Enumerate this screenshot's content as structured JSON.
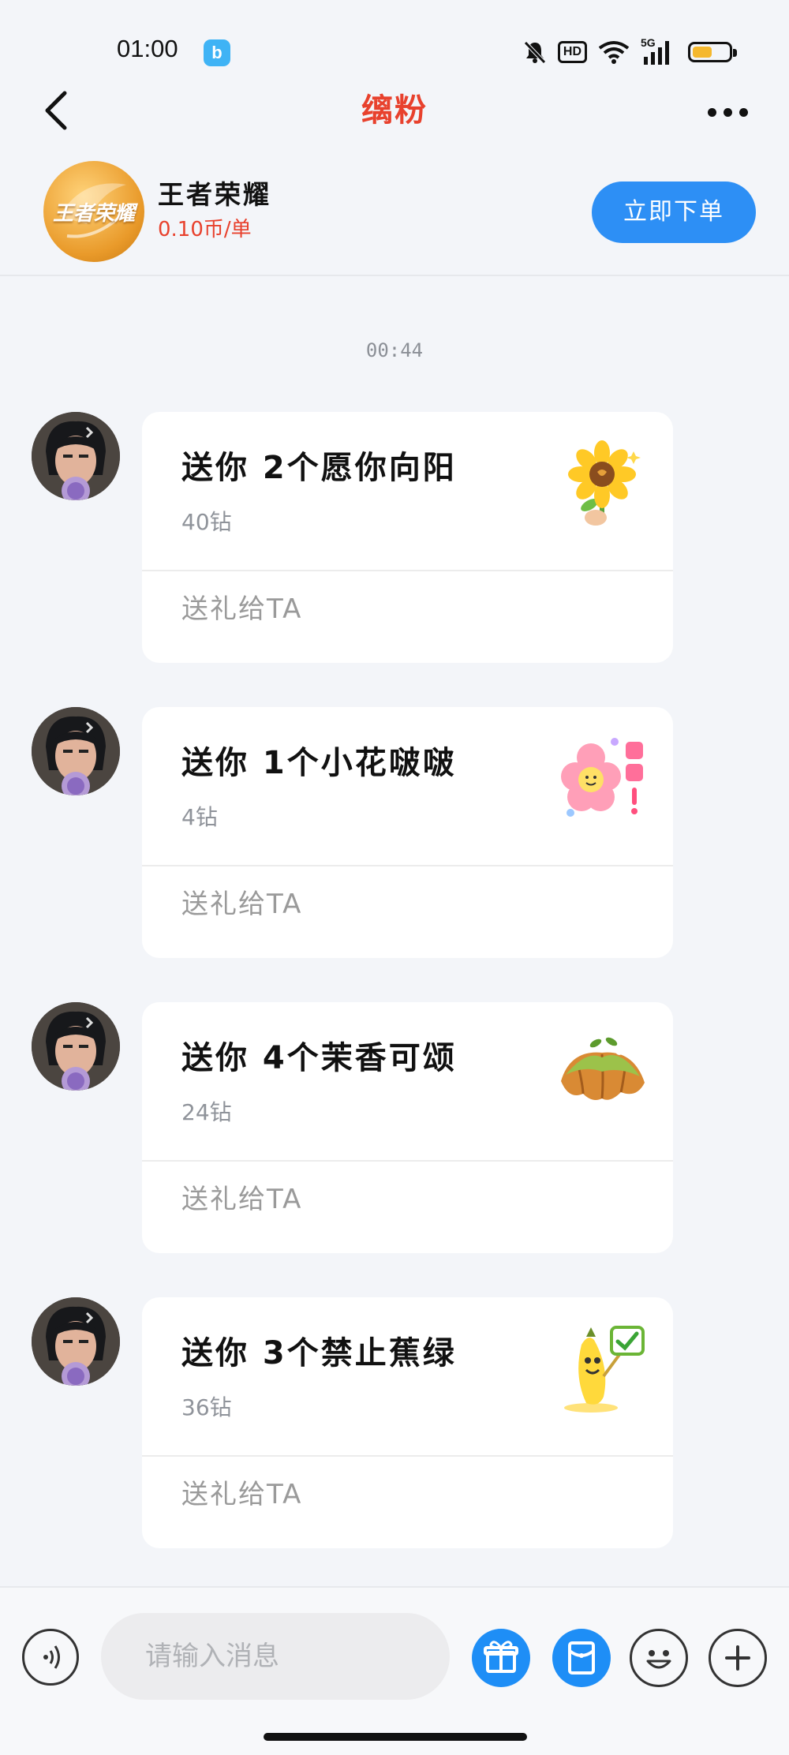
{
  "status_bar": {
    "time": "01:00",
    "app_badge": "b",
    "hd_label": "HD",
    "network_label": "5G"
  },
  "nav": {
    "title": "缡粉"
  },
  "order_header": {
    "logo_text": "王者荣耀",
    "game_name": "王者荣耀",
    "price": "0.10币/单",
    "order_button": "立即下单"
  },
  "chat": {
    "timestamp": "00:44",
    "messages": [
      {
        "title": "送你 2个愿你向阳",
        "price": "40钻",
        "link": "送礼给TA",
        "image_icon": "sunflower-icon"
      },
      {
        "title": "送你 1个小花啵啵",
        "price": "4钻",
        "link": "送礼给TA",
        "image_icon": "pink-flower-icon"
      },
      {
        "title": "送你 4个茉香可颂",
        "price": "24钻",
        "link": "送礼给TA",
        "image_icon": "croissant-icon"
      },
      {
        "title": "送你 3个禁止蕉绿",
        "price": "36钻",
        "link": "送礼给TA",
        "image_icon": "banana-icon"
      }
    ]
  },
  "input_bar": {
    "placeholder": "请输入消息"
  },
  "colors": {
    "accent_blue": "#2d8ff5",
    "title_red": "#e8412d",
    "background": "#f3f5f9"
  }
}
